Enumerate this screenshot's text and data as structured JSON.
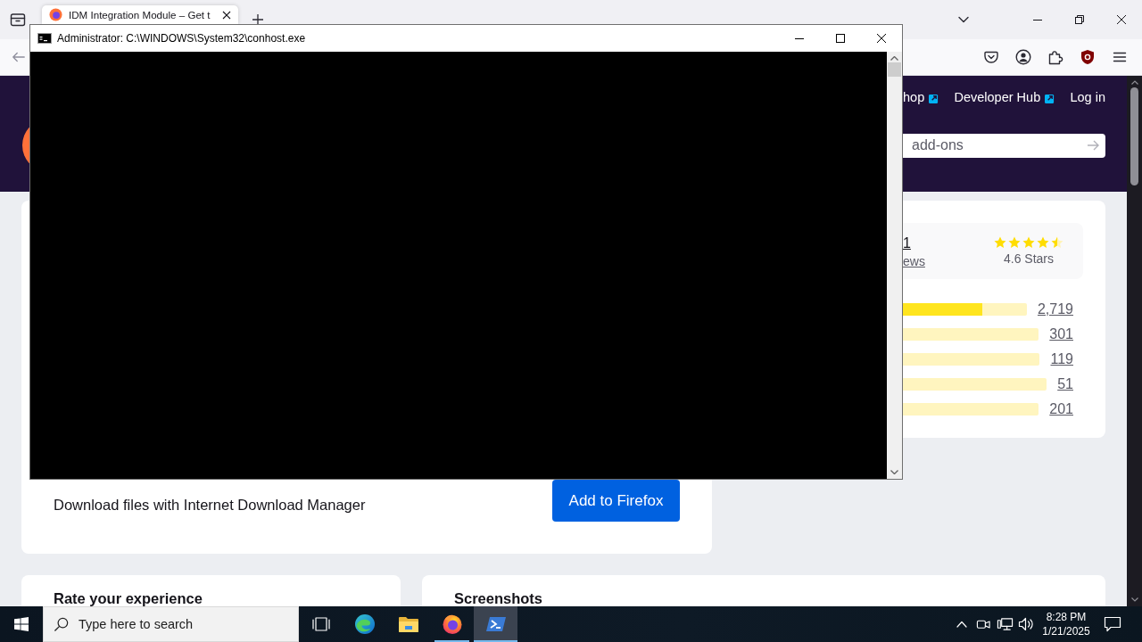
{
  "browser": {
    "tabs": [
      {
        "title": "IDM Integration Module – Get t",
        "selected": true
      }
    ],
    "page": {
      "header": {
        "links": [
          {
            "label": "hop",
            "external": true
          },
          {
            "label": "Developer Hub",
            "external": true
          },
          {
            "label": "Log in",
            "external": false
          }
        ],
        "search": {
          "placeholder": "add-ons"
        }
      },
      "listing": {
        "description": "Download files with Internet Download Manager",
        "button": "Add to Firefox"
      },
      "ratings": {
        "count": "1",
        "reviews_link": "ews",
        "stars": 4.5,
        "average": "4.6 Stars",
        "bars": [
          {
            "count": "2,719",
            "level": 0.64
          },
          {
            "count": "301"
          },
          {
            "count": "119"
          },
          {
            "count": "51"
          },
          {
            "count": "201"
          }
        ]
      },
      "sections": [
        {
          "title": "Rate your experience"
        },
        {
          "title": "Screenshots"
        }
      ]
    }
  },
  "console": {
    "title": "Administrator: C:\\WINDOWS\\System32\\conhost.exe"
  },
  "taskbar": {
    "search": {
      "placeholder": "Type here to search"
    },
    "apps": [
      {
        "kind": "edge",
        "running": false,
        "selected": false
      },
      {
        "kind": "explorer",
        "running": false,
        "selected": false
      },
      {
        "kind": "firefox",
        "running": true,
        "selected": false
      },
      {
        "kind": "powershell",
        "running": true,
        "selected": true
      }
    ],
    "clock": {
      "time": "8:28 PM",
      "date": "1/21/2025"
    }
  }
}
